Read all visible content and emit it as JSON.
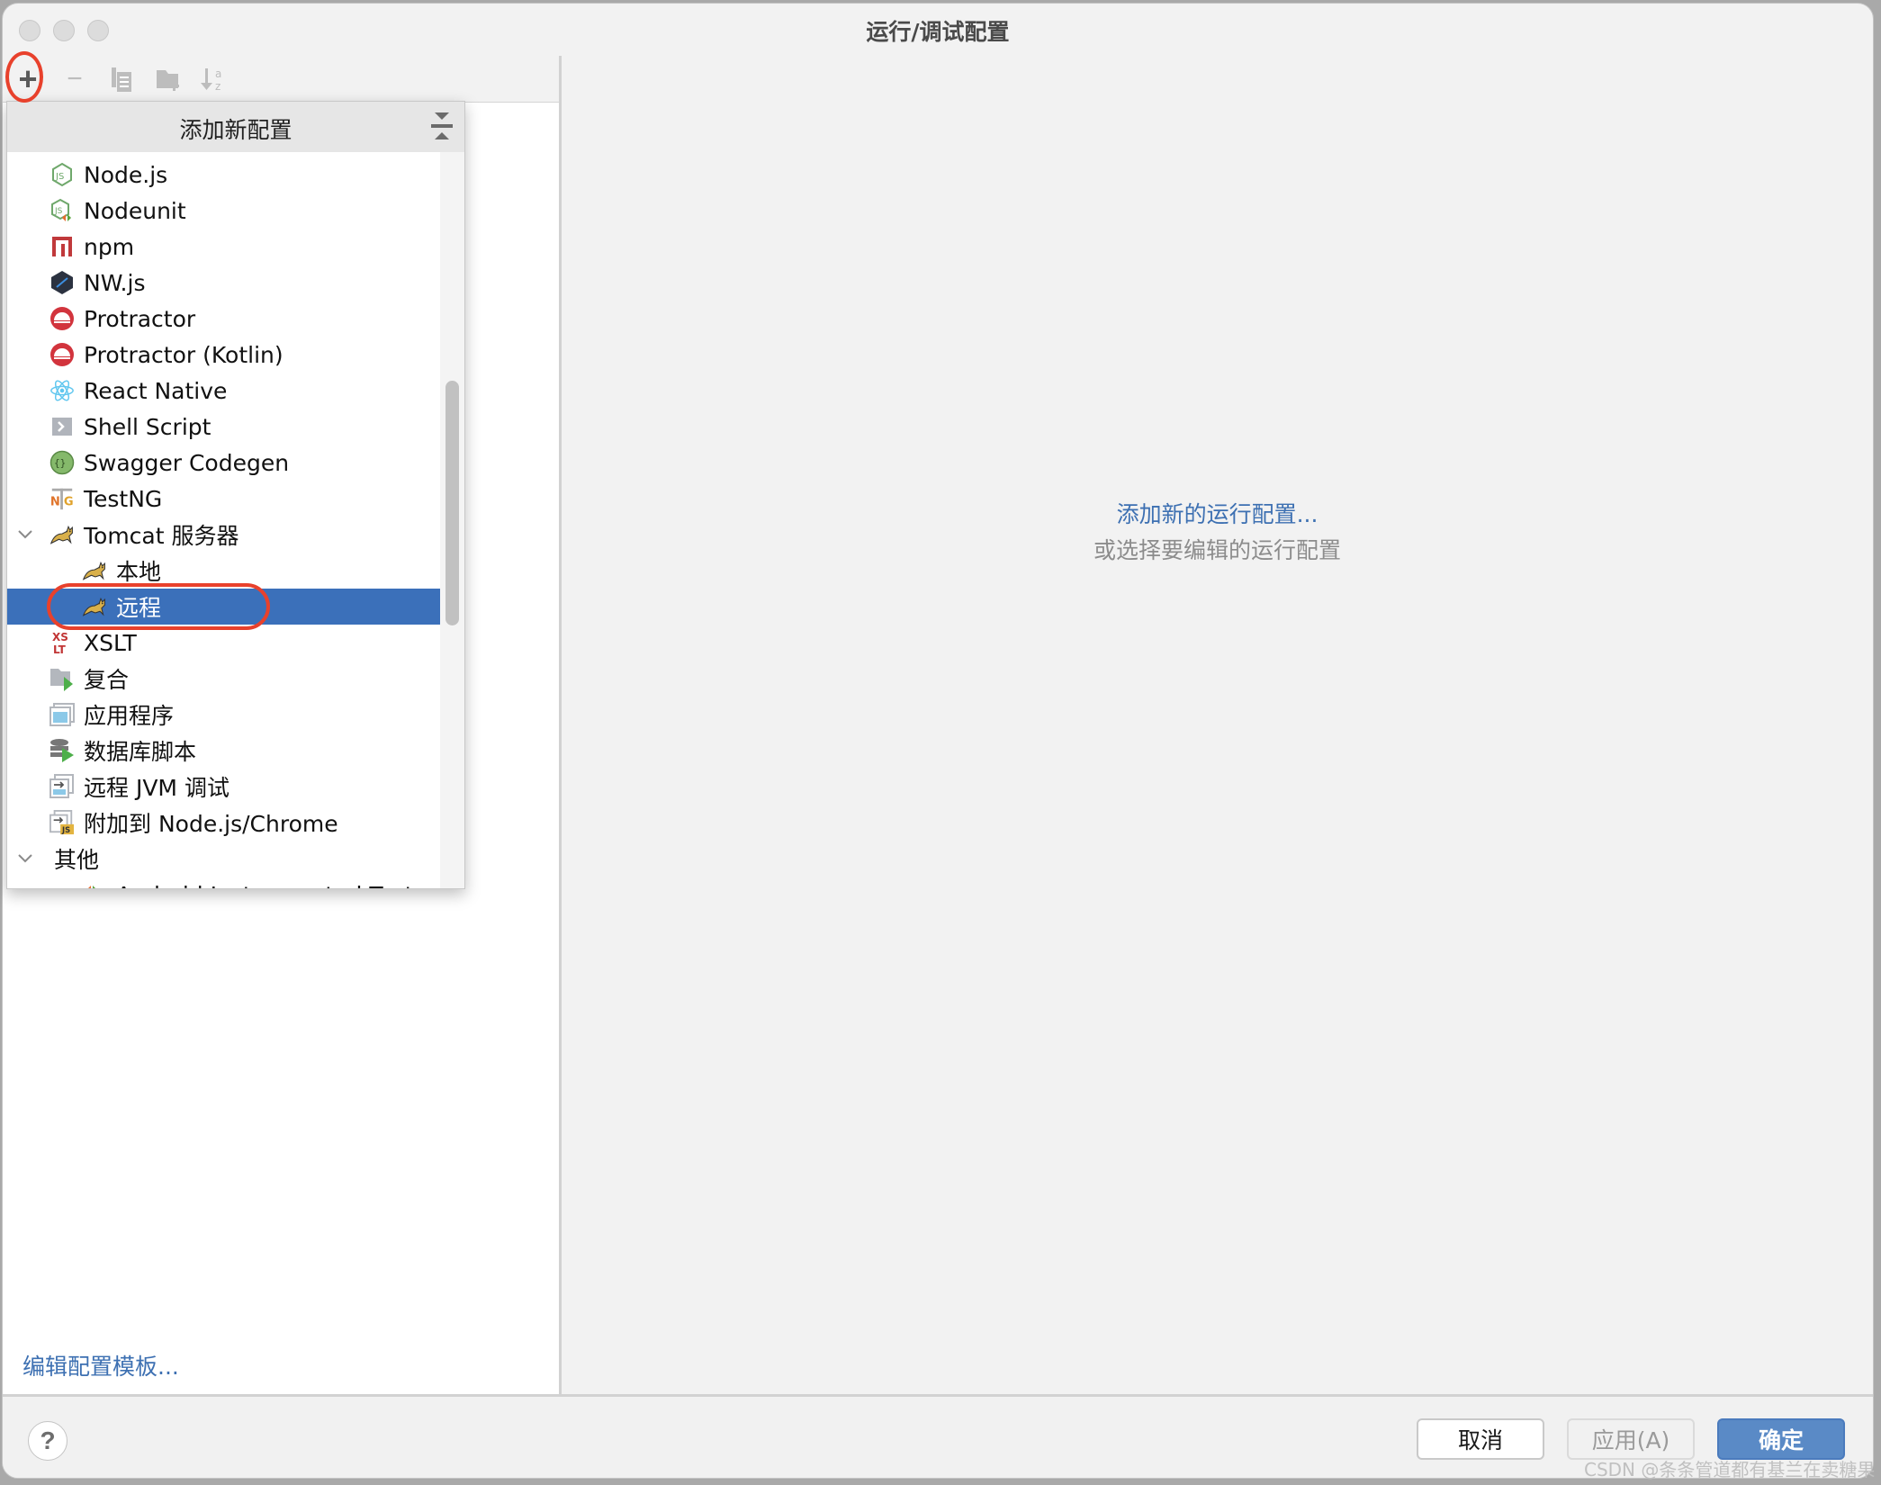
{
  "window": {
    "title": "运行/调试配置",
    "traffic_lights": [
      "close",
      "minimize",
      "zoom"
    ]
  },
  "toolbar": {
    "buttons": [
      {
        "name": "add",
        "icon": "plus-icon",
        "enabled": true
      },
      {
        "name": "remove",
        "icon": "minus-icon",
        "enabled": false
      },
      {
        "name": "copy",
        "icon": "copy-icon",
        "enabled": false
      },
      {
        "name": "new-folder",
        "icon": "folder-add-icon",
        "enabled": false
      },
      {
        "name": "sort",
        "icon": "sort-alpha-icon",
        "enabled": false
      }
    ],
    "add_symbol": "+",
    "remove_symbol": "−"
  },
  "popup": {
    "title": "添加新配置",
    "items": [
      {
        "label": "Node.js",
        "icon": "nodejs-icon",
        "level": 1
      },
      {
        "label": "Nodeunit",
        "icon": "nodeunit-icon",
        "level": 1
      },
      {
        "label": "npm",
        "icon": "npm-icon",
        "level": 1
      },
      {
        "label": "NW.js",
        "icon": "nwjs-icon",
        "level": 1
      },
      {
        "label": "Protractor",
        "icon": "protractor-icon",
        "level": 1
      },
      {
        "label": "Protractor (Kotlin)",
        "icon": "protractor-icon",
        "level": 1
      },
      {
        "label": "React Native",
        "icon": "react-icon",
        "level": 1
      },
      {
        "label": "Shell Script",
        "icon": "shell-script-icon",
        "level": 1
      },
      {
        "label": "Swagger Codegen",
        "icon": "swagger-icon",
        "level": 1
      },
      {
        "label": "TestNG",
        "icon": "testng-icon",
        "level": 1
      },
      {
        "label": "Tomcat 服务器",
        "icon": "tomcat-icon",
        "level": 1,
        "expanded": true
      },
      {
        "label": "本地",
        "icon": "tomcat-icon",
        "level": 2
      },
      {
        "label": "远程",
        "icon": "tomcat-icon",
        "level": 2,
        "selected": true
      },
      {
        "label": "XSLT",
        "icon": "xslt-icon",
        "level": 1
      },
      {
        "label": "复合",
        "icon": "compound-icon",
        "level": 1
      },
      {
        "label": "应用程序",
        "icon": "application-icon",
        "level": 1
      },
      {
        "label": "数据库脚本",
        "icon": "database-script-icon",
        "level": 1
      },
      {
        "label": "远程 JVM 调试",
        "icon": "remote-debug-icon",
        "level": 1
      },
      {
        "label": "附加到 Node.js/Chrome",
        "icon": "attach-nodejs-icon",
        "level": 1
      },
      {
        "label": "其他",
        "icon": "",
        "level": 0,
        "expanded": true
      },
      {
        "label": "Android Instrumented Tests",
        "icon": "android-test-icon",
        "level": 2
      }
    ]
  },
  "right_panel": {
    "add_link": "添加新的运行配置...",
    "hint": "或选择要编辑的运行配置"
  },
  "left_panel": {
    "edit_templates_link": "编辑配置模板..."
  },
  "footer": {
    "help": "?",
    "cancel": "取消",
    "apply": "应用(A)",
    "ok": "确定"
  },
  "watermark": "CSDN @条条管道都有基兰在卖糖果",
  "colors": {
    "accent": "#3b70ba",
    "link": "#3d70b2",
    "annotation": "#e8412c",
    "ok_button": "#5a8ac6"
  }
}
